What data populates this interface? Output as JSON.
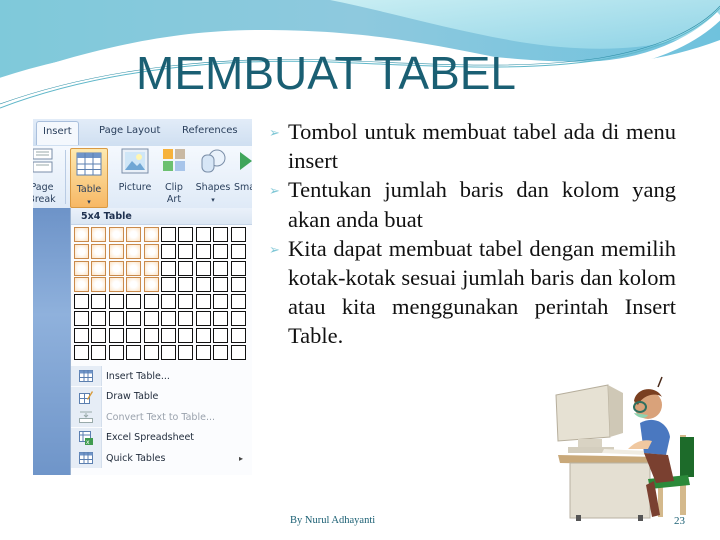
{
  "slide": {
    "title": "MEMBUAT TABEL",
    "footer": "By Nurul Adhayanti",
    "page_number": "23",
    "colors": {
      "title": "#1a5f73",
      "bullet_marker": "#7fc7d6",
      "wave_dark": "#79c3d6",
      "wave_light": "#b8e6ee"
    }
  },
  "word_ui": {
    "tabs": [
      {
        "label": "Insert",
        "active": true
      },
      {
        "label": "Page Layout",
        "active": false
      },
      {
        "label": "References",
        "active": false
      }
    ],
    "ribbon": {
      "page_break": {
        "line1": "Page",
        "line2": "Break"
      },
      "table": {
        "label": "Table",
        "icon": "table-icon"
      },
      "picture": {
        "label": "Picture",
        "icon": "picture-icon"
      },
      "clip_art": {
        "line1": "Clip",
        "line2": "Art",
        "icon": "clipart-icon"
      },
      "shapes": {
        "label": "Shapes",
        "icon": "shapes-icon"
      },
      "smartart": {
        "label": "Sma",
        "icon": "smartart-icon"
      }
    },
    "dropdown": {
      "header": "5x4 Table",
      "grid": {
        "columns": 10,
        "rows": 8,
        "selected_columns": 5,
        "selected_rows": 4
      },
      "menu_items": [
        {
          "label": "Insert Table...",
          "icon": "insert-table-icon",
          "disabled": false,
          "submenu": false
        },
        {
          "label": "Draw Table",
          "icon": "draw-table-icon",
          "disabled": false,
          "submenu": false
        },
        {
          "label": "Convert Text to Table...",
          "icon": "convert-text-icon",
          "disabled": true,
          "submenu": false
        },
        {
          "label": "Excel Spreadsheet",
          "icon": "excel-spreadsheet-icon",
          "disabled": false,
          "submenu": false
        },
        {
          "label": "Quick Tables",
          "icon": "quick-tables-icon",
          "disabled": false,
          "submenu": true
        }
      ],
      "submenu_arrow": "▸"
    }
  },
  "bullets": {
    "marker": "➢",
    "items": [
      "Tombol untuk membuat tabel ada di menu insert",
      "Tentukan jumlah baris dan kolom yang akan anda buat",
      "Kita dapat membuat tabel dengan memilih kotak-kotak sesuai jumlah baris dan kolom atau kita menggunakan perintah Insert Table."
    ]
  }
}
